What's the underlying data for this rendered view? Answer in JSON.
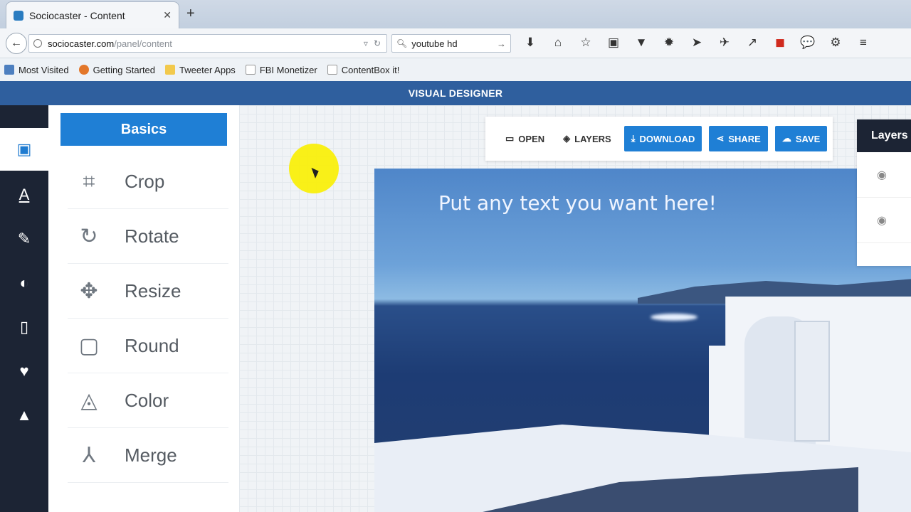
{
  "browser": {
    "tab_title": "Sociocaster - Content",
    "close_glyph": "✕",
    "newtab_glyph": "+",
    "back_glyph": "←",
    "url_host": "sociocaster.com",
    "url_path": "/panel/content",
    "url_dropdown_glyph": "▿",
    "reload_glyph": "↻",
    "search_value": "youtube hd",
    "search_go_glyph": "→",
    "toolbar_icons": [
      "download-icon",
      "home-icon",
      "star-icon",
      "clipboard-icon",
      "pocket-icon",
      "extension-icon",
      "send-icon",
      "tools-icon",
      "pin-icon",
      "red-square-icon",
      "chat-icon",
      "puzzle-icon",
      "menu-icon"
    ],
    "toolbar_glyphs": [
      "⬇",
      "⌂",
      "☆",
      "▣",
      "▼",
      "✹",
      "▾",
      "➤",
      "✈",
      "▾",
      "↗",
      "◼",
      "💬",
      "⚙",
      "≡"
    ]
  },
  "bookmarks": [
    {
      "label": "Most Visited"
    },
    {
      "label": "Getting Started"
    },
    {
      "label": "Tweeter Apps"
    },
    {
      "label": "FBI Monetizer"
    },
    {
      "label": "ContentBox it!"
    }
  ],
  "app": {
    "header_title": "VISUAL DESIGNER",
    "leftnav_icons": [
      "image-icon",
      "text-icon",
      "brush-icon",
      "brightness-icon",
      "frame-icon",
      "heart-icon",
      "landscape-icon"
    ],
    "leftnav_glyphs": [
      "▣",
      "A",
      "✎",
      "◐",
      "▯",
      "♥",
      "▲"
    ],
    "panel": {
      "section_title": "Basics",
      "tools": [
        {
          "label": "Crop",
          "icon": "crop-icon",
          "glyph": "⌗"
        },
        {
          "label": "Rotate",
          "icon": "rotate-icon",
          "glyph": "↻"
        },
        {
          "label": "Resize",
          "icon": "resize-icon",
          "glyph": "✥"
        },
        {
          "label": "Round",
          "icon": "round-icon",
          "glyph": "▢"
        },
        {
          "label": "Color",
          "icon": "color-icon",
          "glyph": "◬"
        },
        {
          "label": "Merge",
          "icon": "merge-icon",
          "glyph": "⅄"
        }
      ]
    },
    "actions": {
      "open_label": "OPEN",
      "open_glyph": "▭",
      "layers_label": "LAYERS",
      "layers_glyph": "◈",
      "download_label": "DOWNLOAD",
      "download_glyph": "⤓",
      "share_label": "SHARE",
      "share_glyph": "⋖",
      "save_label": "SAVE",
      "save_glyph": "☁"
    },
    "layers_panel": {
      "title": "Layers",
      "row_glyph": "◉"
    },
    "canvas_text": "Put any text you want here!"
  },
  "colors": {
    "header_blue": "#2f5f9e",
    "accent_blue": "#1f7fd5",
    "nav_dark": "#1c2434",
    "cursor_highlight": "#faf000"
  }
}
